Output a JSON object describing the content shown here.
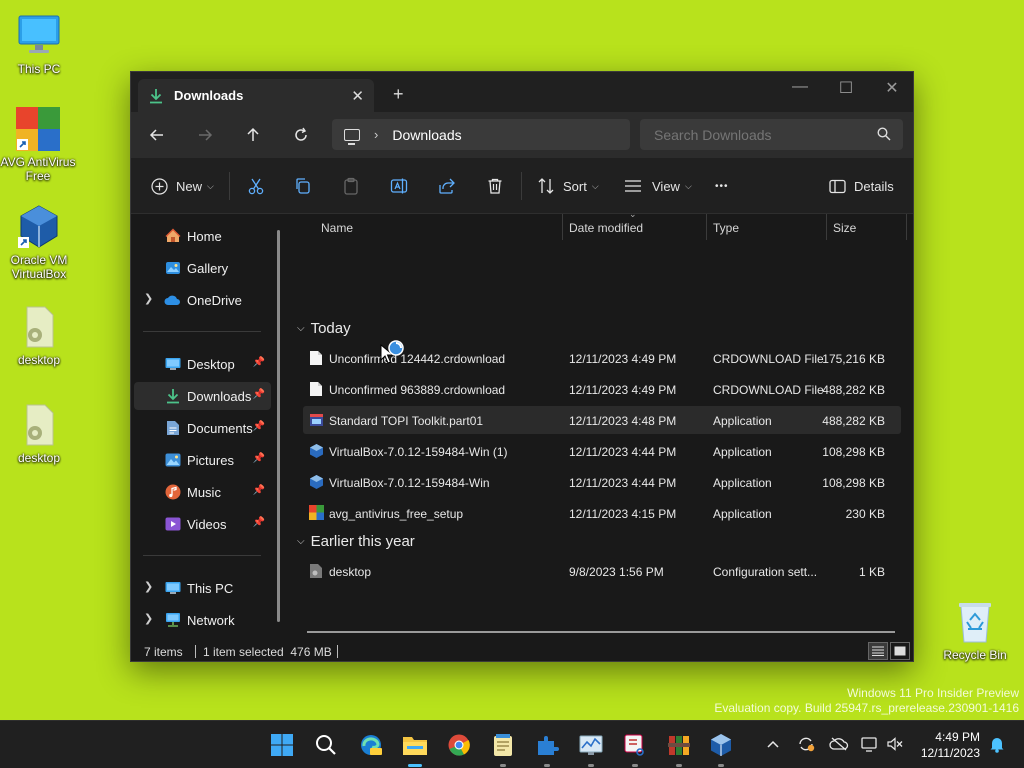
{
  "desktop": {
    "icons": [
      {
        "label": "This PC"
      },
      {
        "label": "AVG AntiVirus Free"
      },
      {
        "label": "Oracle VM VirtualBox"
      },
      {
        "label": "desktop"
      },
      {
        "label": "desktop"
      },
      {
        "label": "Recycle Bin"
      }
    ],
    "watermark_line1": "Windows 11 Pro Insider Preview",
    "watermark_line2": "Evaluation copy. Build 25947.rs_prerelease.230901-1416"
  },
  "window": {
    "tab_title": "Downloads",
    "close_tab_glyph": "✕",
    "new_tab_glyph": "+",
    "minimize_glyph": "—",
    "maximize_glyph": "☐",
    "close_glyph": "✕",
    "address_crumb": "Downloads",
    "search_placeholder": "Search Downloads"
  },
  "toolbar": {
    "new_label": "New",
    "sort_label": "Sort",
    "view_label": "View",
    "more_glyph": "•••",
    "details_label": "Details"
  },
  "sidebar": {
    "items": [
      {
        "label": "Home"
      },
      {
        "label": "Gallery"
      },
      {
        "label": "OneDrive"
      },
      {
        "label": "Desktop"
      },
      {
        "label": "Downloads"
      },
      {
        "label": "Documents"
      },
      {
        "label": "Pictures"
      },
      {
        "label": "Music"
      },
      {
        "label": "Videos"
      },
      {
        "label": "This PC"
      },
      {
        "label": "Network"
      }
    ]
  },
  "columns": {
    "name": "Name",
    "date": "Date modified",
    "type": "Type",
    "size": "Size"
  },
  "groups": {
    "today": "Today",
    "earlier": "Earlier this year"
  },
  "files": [
    {
      "name": "Unconfirmed 124442.crdownload",
      "date": "12/11/2023 4:49 PM",
      "type": "CRDOWNLOAD File",
      "size": "175,216 KB"
    },
    {
      "name": "Unconfirmed 963889.crdownload",
      "date": "12/11/2023 4:49 PM",
      "type": "CRDOWNLOAD File",
      "size": "488,282 KB"
    },
    {
      "name": "Standard TOPI Toolkit.part01",
      "date": "12/11/2023 4:48 PM",
      "type": "Application",
      "size": "488,282 KB"
    },
    {
      "name": "VirtualBox-7.0.12-159484-Win (1)",
      "date": "12/11/2023 4:44 PM",
      "type": "Application",
      "size": "108,298 KB"
    },
    {
      "name": "VirtualBox-7.0.12-159484-Win",
      "date": "12/11/2023 4:44 PM",
      "type": "Application",
      "size": "108,298 KB"
    },
    {
      "name": "avg_antivirus_free_setup",
      "date": "12/11/2023 4:15 PM",
      "type": "Application",
      "size": "230 KB"
    },
    {
      "name": "desktop",
      "date": "9/8/2023 1:56 PM",
      "type": "Configuration sett...",
      "size": "1 KB"
    }
  ],
  "status": {
    "items_count": "7 items",
    "selection": "1 item selected  476 MB"
  },
  "taskbar": {
    "time": "4:49 PM",
    "date": "12/11/2023",
    "tray_chevron": "^"
  },
  "colors": {
    "desktop_bg": "#b8e21c",
    "accent": "#4cc2ff",
    "window_bg": "#191919"
  }
}
